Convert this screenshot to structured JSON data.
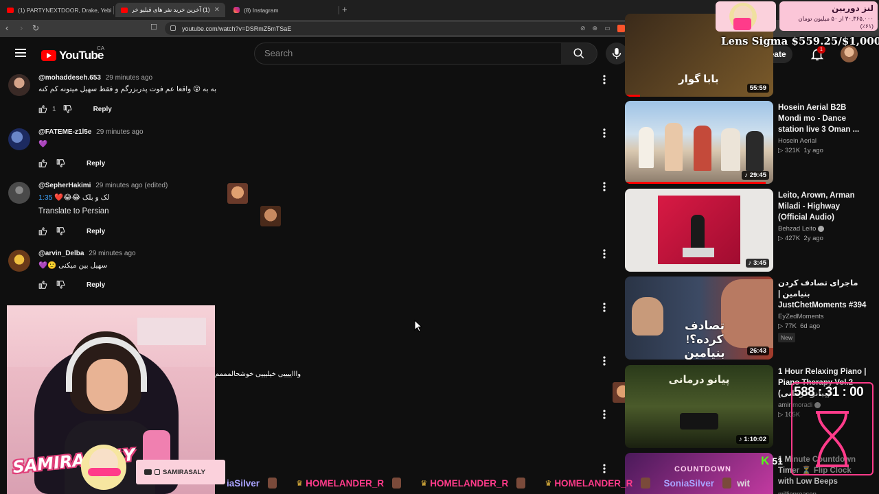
{
  "browser": {
    "tabs": [
      {
        "label": "(1) PARTYNEXTDOOR, Drake, Yebba"
      },
      {
        "label": "(1) آخرین خرید نفر های قبلیو خرید"
      },
      {
        "label": "(8) Instagram"
      }
    ],
    "url": "youtube.com/watch?v=DSRmZ5mTSaE"
  },
  "youtube": {
    "country": "CA",
    "logo_text": "YouTube",
    "search_placeholder": "Search",
    "create_label": "Create",
    "notification_count": "1"
  },
  "comments": [
    {
      "author": "@mohaddeseh.653",
      "time": "29 minutes ago",
      "text": "به به 😮 واقعا عم فوت پدربزرگم و فقط سهیل میتونه کم کنه",
      "likes": "1",
      "reply": "Reply"
    },
    {
      "author": "@FATEME-z1l5e",
      "time": "29 minutes ago",
      "text": "💜",
      "likes": "",
      "reply": "Reply"
    },
    {
      "author": "@SepherHakimi",
      "time": "29 minutes ago (edited)",
      "text": "لک و بلک 😂😂❤️",
      "timestamp": "1:35",
      "translate": "Translate to Persian",
      "likes": "",
      "reply": "Reply"
    },
    {
      "author": "@arvin_Delba",
      "time": "29 minutes ago",
      "text": "سهیل بین میکنی 🙂💜",
      "likes": "",
      "reply": "Reply"
    }
  ],
  "floating_comment_text": "واااییییی خیلیییی خوشحالمممم",
  "sidebar": [
    {
      "title": "",
      "channel": "",
      "views": "",
      "age": "",
      "duration": "55:59",
      "thumb_text": "بابا گوار",
      "progress": 0.1,
      "colors": [
        "#3a2a1a",
        "#7a5a2a"
      ]
    },
    {
      "title": "Hosein Aerial B2B Mondi mo - Dance station live 3 Oman ...",
      "channel": "Hosein Aerial",
      "views": "321K",
      "age": "1y ago",
      "duration": "29:45",
      "progress": 0.95,
      "colors": [
        "#8fb4d8",
        "#d8c8b0"
      ]
    },
    {
      "title": "Leito, Arown, Arman Miladi - Highway (Official Audio)",
      "channel": "Behzad Leito",
      "verified": true,
      "views": "427K",
      "age": "2y ago",
      "duration": "3:45",
      "progress": 0,
      "colors": [
        "#e9e7e4",
        "#c4103a"
      ]
    },
    {
      "title": "ماجرای تصادف کردن بنیامین | JustChetMoments #394",
      "channel": "EyZedMoments",
      "views": "77K",
      "age": "6d ago",
      "duration": "26:43",
      "badge": "New",
      "thumb_text": "تصادف کرده؟! بنیامین",
      "progress": 0,
      "colors": [
        "#2a3446",
        "#a33b2a"
      ]
    },
    {
      "title": "1 Hour Relaxing Piano | Piano Therapy Vol.2 (پیانو درمانی)",
      "channel": "amir moradi",
      "verified": true,
      "views": "105K",
      "age": "",
      "duration": "1:10:02",
      "thumb_text": "پیانو درمانی",
      "progress": 0,
      "colors": [
        "#1f2a14",
        "#6b7a3a"
      ]
    },
    {
      "title": "1 Minute Countdown Timer ⏳ Flip Clock with Low Beeps Every...",
      "channel": "millionreason",
      "views": "",
      "age": "",
      "duration": "",
      "thumb_text": "COUNTDOWN",
      "progress": 0,
      "colors": [
        "#4a1a5a",
        "#c23aa0"
      ]
    }
  ],
  "overlay": {
    "lens_title": "لنز دوربین",
    "lens_sub": "۳۰,۳۶۵,۰۰۰ از ۵۰ میلیون تومان (۶۱٪)",
    "lens_price": "Lens Sigma $559.25/$1,000",
    "timer": "588 : 31 : 00",
    "streamer_name": "SAMIRA SALY",
    "social_handle": "SAMIRASALY",
    "ticker": [
      "iaSilver",
      "HOMELANDER_R",
      "HOMELANDER_R",
      "HOMELANDER_R",
      "SoniaSilver",
      "wit"
    ],
    "kick_viewers": "51",
    "brand_colors": {
      "pink": "#ff3b8a",
      "kick_green": "#53fc18"
    }
  }
}
